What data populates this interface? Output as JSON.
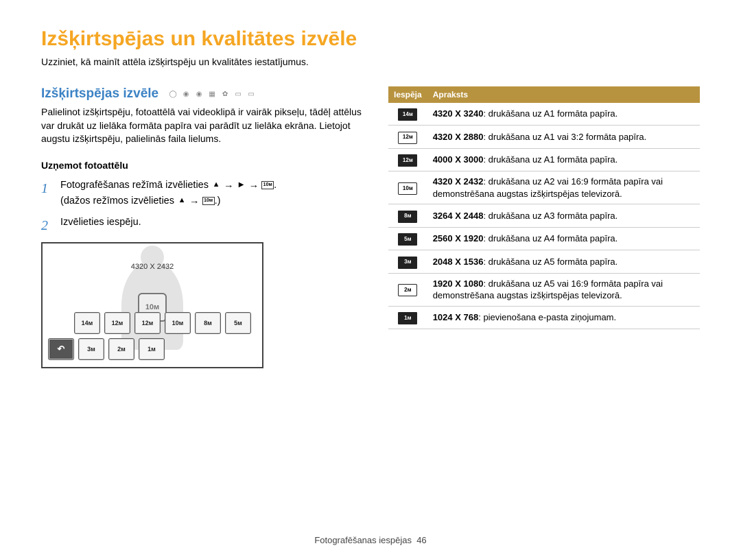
{
  "page": {
    "title": "Izšķirtspējas un kvalitātes izvēle",
    "subtitle": "Uzziniet, kā mainīt attēla izšķirtspēju un kvalitātes iestatījumus."
  },
  "left": {
    "heading": "Izšķirtspējas izvēle",
    "paragraph": "Palielinot izšķirtspēju, fotoattēlā vai videoklipā ir vairāk pikseļu, tādēļ attēlus var drukāt uz lielāka formāta papīra vai parādīt uz lielāka ekrāna. Lietojot augstu izšķirtspēju, palielinās faila lielums.",
    "subheading": "Uzņemot fotoattēlu",
    "step1a": "Fotografēšanas režīmā izvēlieties",
    "step1b": "(dažos režīmos izvēlieties",
    "step2": "Izvēlieties iespēju.",
    "lcd": {
      "label": "4320 X 2432",
      "center": "10м",
      "row1": [
        "14м",
        "12м",
        "12м",
        "10м",
        "8м",
        "5м"
      ],
      "row2": [
        "↶",
        "3м",
        "2м",
        "1м"
      ]
    }
  },
  "table": {
    "head": {
      "col1": "Iespēja",
      "col2": "Apraksts"
    },
    "rows": [
      {
        "badge": "14м",
        "solid": true,
        "bold": "4320 X 3240",
        "text": ": drukāšana uz A1 formāta papīra."
      },
      {
        "badge": "12м",
        "solid": false,
        "bold": "4320 X 2880",
        "text": ": drukāšana uz A1 vai 3:2 formāta papīra."
      },
      {
        "badge": "12м",
        "solid": true,
        "bold": "4000 X 3000",
        "text": ": drukāšana uz A1 formāta papīra."
      },
      {
        "badge": "10м",
        "solid": false,
        "bold": "4320 X 2432",
        "text": ": drukāšana uz A2 vai 16:9 formāta papīra vai demonstrēšana augstas izšķirtspējas televizorā."
      },
      {
        "badge": "8м",
        "solid": true,
        "bold": "3264 X 2448",
        "text": ": drukāšana uz A3 formāta papīra."
      },
      {
        "badge": "5м",
        "solid": true,
        "bold": "2560 X 1920",
        "text": ": drukāšana uz A4 formāta papīra."
      },
      {
        "badge": "3м",
        "solid": true,
        "bold": "2048 X 1536",
        "text": ": drukāšana uz A5 formāta papīra."
      },
      {
        "badge": "2м",
        "solid": false,
        "bold": "1920 X 1080",
        "text": ": drukāšana uz A5 vai 16:9 formāta papīra vai demonstrēšana augstas izšķirtspējas televizorā."
      },
      {
        "badge": "1м",
        "solid": true,
        "bold": "1024 X 768",
        "text": ": pievienošana e-pasta ziņojumam."
      }
    ]
  },
  "footer": {
    "text": "Fotografēšanas iespējas",
    "page": "46"
  }
}
